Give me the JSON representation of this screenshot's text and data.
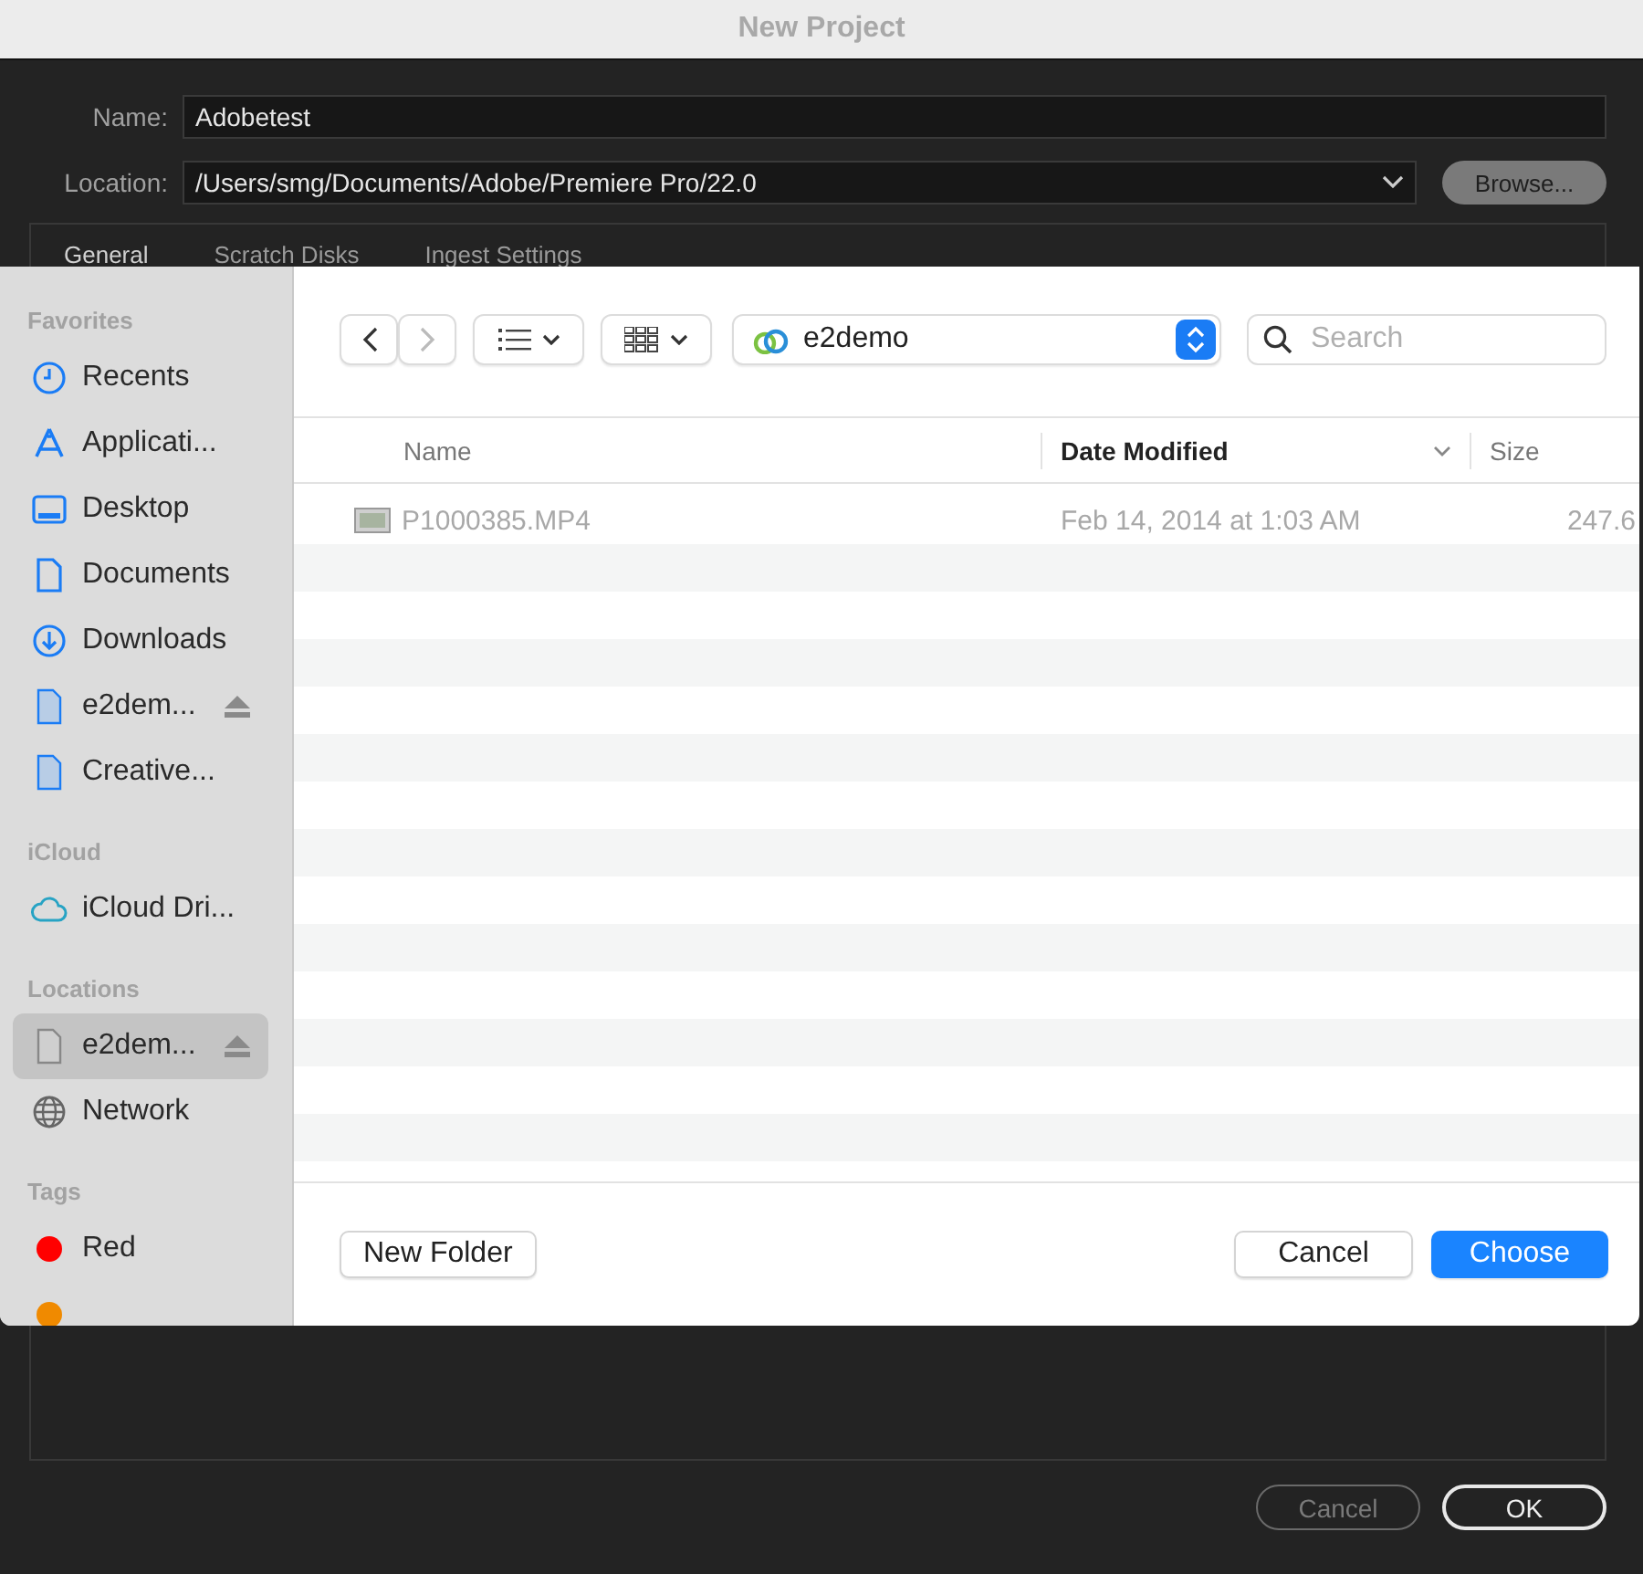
{
  "window": {
    "title": "New Project"
  },
  "name_field": {
    "label": "Name:",
    "value": "Adobetest"
  },
  "location_field": {
    "label": "Location:",
    "value": "/Users/smg/Documents/Adobe/Premiere Pro/22.0"
  },
  "browse_button": "Browse...",
  "tabs": [
    {
      "label": "General",
      "selected": true
    },
    {
      "label": "Scratch Disks",
      "selected": false
    },
    {
      "label": "Ingest Settings",
      "selected": false
    }
  ],
  "dialog_buttons": [
    {
      "label": "Cancel",
      "disabled": true
    },
    {
      "label": "OK",
      "disabled": false
    }
  ],
  "file_sheet": {
    "sidebar": [
      {
        "title": "Favorites",
        "items": [
          {
            "label": "Recents",
            "kind": "clock",
            "selected": false,
            "ejectable": false
          },
          {
            "label": "Applicati...",
            "kind": "apps",
            "selected": false,
            "ejectable": false
          },
          {
            "label": "Desktop",
            "kind": "desktop",
            "selected": false,
            "ejectable": false
          },
          {
            "label": "Documents",
            "kind": "document",
            "selected": false,
            "ejectable": false
          },
          {
            "label": "Downloads",
            "kind": "download",
            "selected": false,
            "ejectable": false
          },
          {
            "label": "e2dem...",
            "kind": "volume",
            "selected": false,
            "ejectable": true
          },
          {
            "label": "Creative...",
            "kind": "volume",
            "selected": false,
            "ejectable": false
          }
        ]
      },
      {
        "title": "iCloud",
        "items": [
          {
            "label": "iCloud Dri...",
            "kind": "cloud",
            "selected": false,
            "ejectable": false
          }
        ]
      },
      {
        "title": "Locations",
        "items": [
          {
            "label": "e2dem...",
            "kind": "drive",
            "selected": true,
            "ejectable": true
          },
          {
            "label": "Network",
            "kind": "globe",
            "selected": false,
            "ejectable": false
          }
        ]
      },
      {
        "title": "Tags",
        "items": [
          {
            "label": "Red",
            "kind": "tag",
            "color": "#ff0000",
            "selected": false,
            "ejectable": false
          },
          {
            "kind": "tag",
            "color": "#f08a00",
            "selected": false,
            "ejectable": false
          }
        ]
      }
    ],
    "path": "e2demo",
    "search": {
      "placeholder": "Search"
    },
    "columns": [
      {
        "label": "Name",
        "sorted": false
      },
      {
        "label": "Date Modified",
        "sorted": true
      },
      {
        "label": "Size",
        "sorted": false
      }
    ],
    "files": [
      {
        "name": "P1000385.MP4",
        "date": "Feb 14, 2014 at 1:03 AM",
        "size": "247.6",
        "disabled": true
      }
    ],
    "buttons": [
      {
        "label": "New Folder",
        "kind": "plain"
      },
      {
        "label": "Cancel",
        "kind": "plain"
      },
      {
        "label": "Choose",
        "kind": "primary"
      }
    ]
  }
}
